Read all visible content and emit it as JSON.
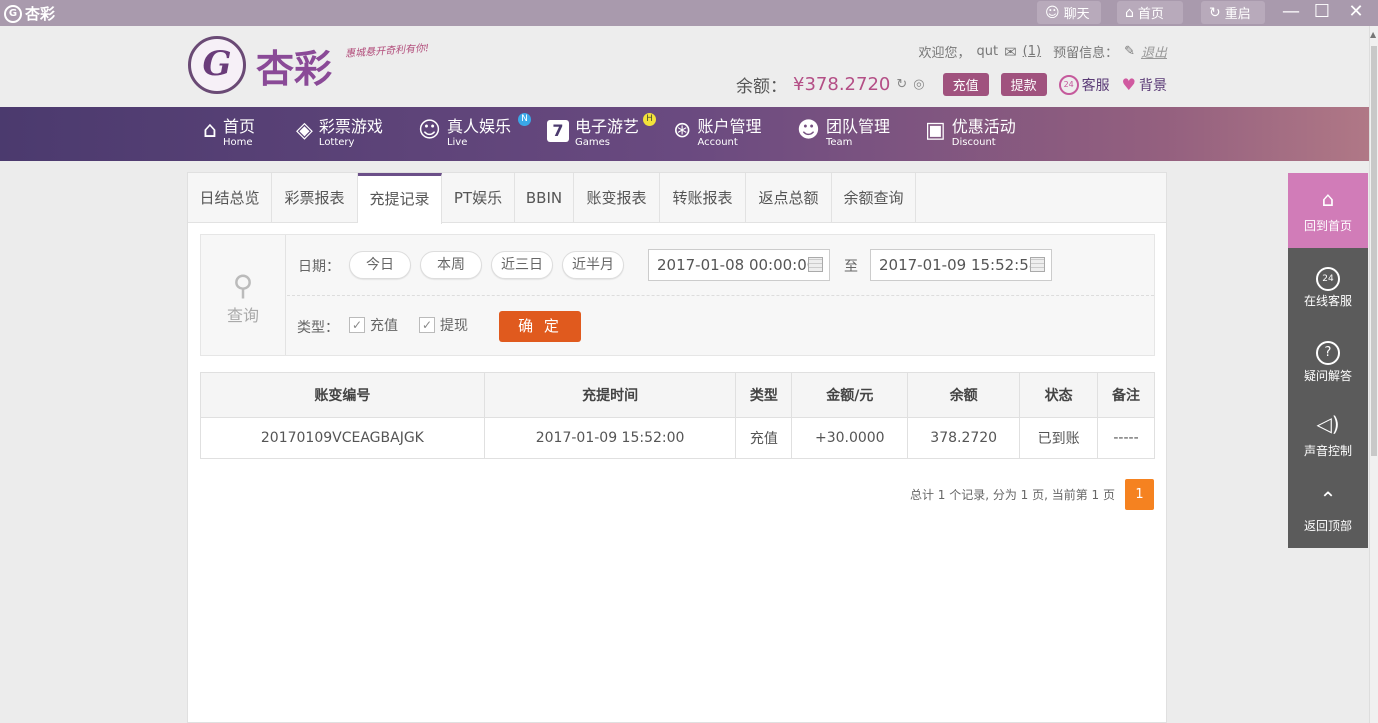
{
  "titlebar": {
    "app_name": "杏彩",
    "chat": "聊天",
    "home": "首页",
    "restart": "重启"
  },
  "header": {
    "logo_text": "杏彩",
    "slogan": "惠城悬开奇利有你!",
    "welcome": "欢迎您，",
    "username": "qut",
    "mail_count": "(1)",
    "reserve_label": "预留信息：",
    "logout": "退出",
    "balance_label": "余额：",
    "balance_value": "¥378.2720",
    "deposit": "充值",
    "withdraw": "提款",
    "service": "客服",
    "background": "背景"
  },
  "nav": [
    {
      "cn": "首页",
      "en": "Home",
      "icon": "home-icon"
    },
    {
      "cn": "彩票游戏",
      "en": "Lottery",
      "icon": "lottery-icon"
    },
    {
      "cn": "真人娱乐",
      "en": "Live",
      "icon": "live-icon",
      "badge": "N"
    },
    {
      "cn": "电子游艺",
      "en": "Games",
      "icon": "games-icon",
      "badge": "H"
    },
    {
      "cn": "账户管理",
      "en": "Account",
      "icon": "account-icon"
    },
    {
      "cn": "团队管理",
      "en": "Team",
      "icon": "team-icon"
    },
    {
      "cn": "优惠活动",
      "en": "Discount",
      "icon": "gift-icon"
    }
  ],
  "tabs": [
    "日结总览",
    "彩票报表",
    "充提记录",
    "PT娱乐",
    "BBIN",
    "账变报表",
    "转账报表",
    "返点总额",
    "余额查询"
  ],
  "active_tab": "充提记录",
  "query": {
    "title": "查询",
    "date_label": "日期：",
    "quick": [
      "今日",
      "本周",
      "近三日",
      "近半月"
    ],
    "start": "2017-01-08 00:00:00",
    "to": "至",
    "end": "2017-01-09 15:52:58",
    "type_label": "类型：",
    "types": [
      "充值",
      "提现"
    ],
    "confirm": "确 定"
  },
  "table": {
    "headers": [
      "账变编号",
      "充提时间",
      "类型",
      "金额/元",
      "余额",
      "状态",
      "备注"
    ],
    "rows": [
      [
        "20170109VCEAGBAJGK",
        "2017-01-09 15:52:00",
        "充值",
        "+30.0000",
        "378.2720",
        "已到账",
        "-----"
      ]
    ]
  },
  "pager": {
    "summary": "总计 1 个记录, 分为 1 页, 当前第 1 页",
    "page": "1"
  },
  "side": [
    {
      "label": "回到首页",
      "icon": "home-icon"
    },
    {
      "label": "在线客服",
      "icon": "headset-icon"
    },
    {
      "label": "疑问解答",
      "icon": "question-icon"
    },
    {
      "label": "声音控制",
      "icon": "speaker-icon"
    },
    {
      "label": "返回顶部",
      "icon": "back-to-top-icon"
    }
  ],
  "colors": {
    "accent": "#a0527e",
    "nav_start": "#4b3a6e",
    "confirm": "#e05a1e",
    "pager": "#f58220"
  }
}
